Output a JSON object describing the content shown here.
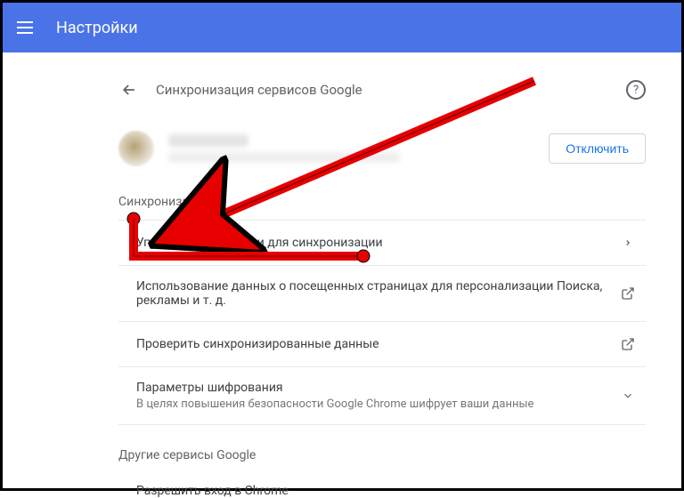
{
  "header": {
    "title": "Настройки"
  },
  "page": {
    "title": "Синхронизация сервисов Google"
  },
  "account": {
    "disconnect": "Отключить"
  },
  "sections": {
    "sync_label": "Синхронизация",
    "other_label": "Другие сервисы Google"
  },
  "rows": {
    "manage_data": "Управление данными для синхронизации",
    "usage_data": "Использование данных о посещенных страницах для персонализации Поиска, рекламы и т. д.",
    "check_synced": "Проверить синхронизированные данные",
    "encryption_title": "Параметры шифрования",
    "encryption_sub": "В целях повышения безопасности Google Chrome шифрует ваши данные",
    "allow_signin": "Разрешить вход в Chrome"
  }
}
